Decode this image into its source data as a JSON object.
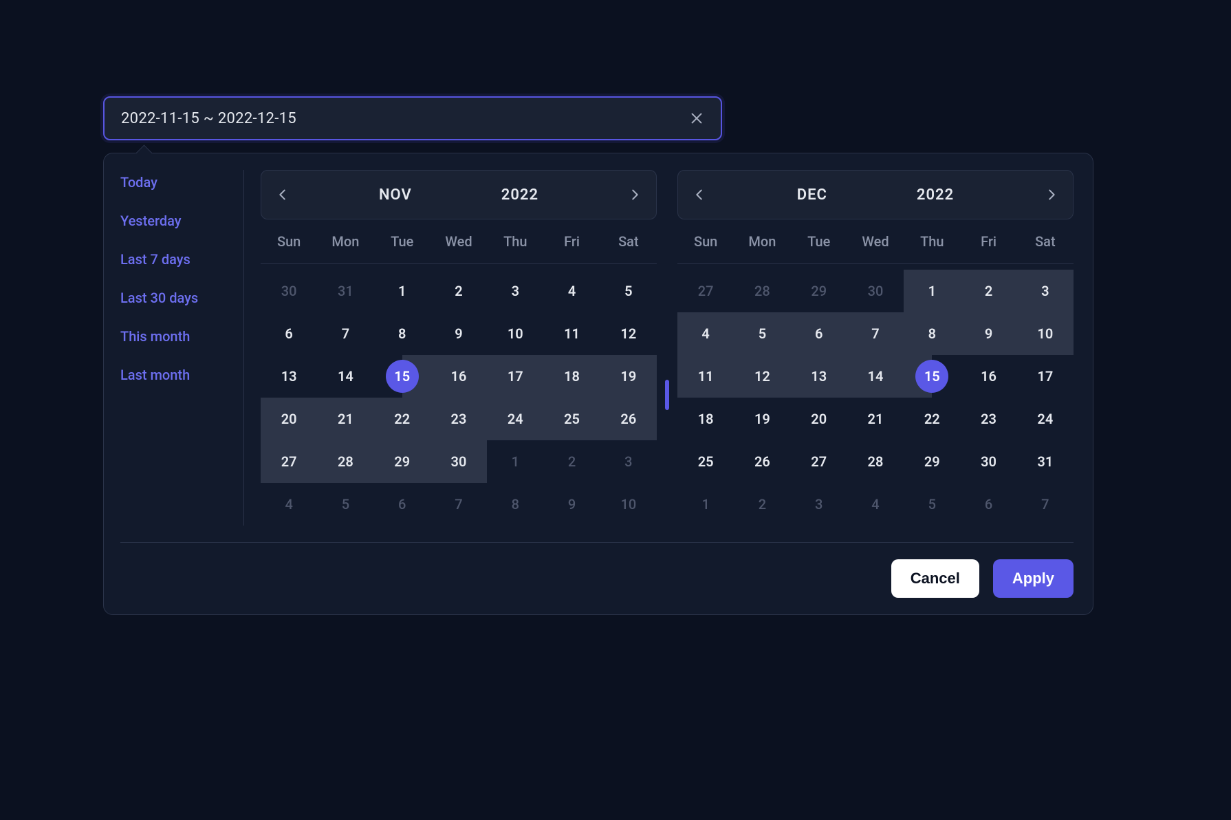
{
  "input": {
    "value": "2022-11-15 ~ 2022-12-15"
  },
  "presets": {
    "items": [
      "Today",
      "Yesterday",
      "Last 7 days",
      "Last 30 days",
      "This month",
      "Last month"
    ]
  },
  "calendars": {
    "weekdays": [
      "Sun",
      "Mon",
      "Tue",
      "Wed",
      "Thu",
      "Fri",
      "Sat"
    ],
    "left": {
      "month": "NOV",
      "year": "2022",
      "days": [
        {
          "n": "30",
          "o": true
        },
        {
          "n": "31",
          "o": true
        },
        {
          "n": "1"
        },
        {
          "n": "2"
        },
        {
          "n": "3"
        },
        {
          "n": "4"
        },
        {
          "n": "5"
        },
        {
          "n": "6"
        },
        {
          "n": "7"
        },
        {
          "n": "8"
        },
        {
          "n": "9"
        },
        {
          "n": "10"
        },
        {
          "n": "11"
        },
        {
          "n": "12"
        },
        {
          "n": "13"
        },
        {
          "n": "14"
        },
        {
          "n": "15",
          "start": true
        },
        {
          "n": "16",
          "r": true
        },
        {
          "n": "17",
          "r": true
        },
        {
          "n": "18",
          "r": true
        },
        {
          "n": "19",
          "r": true
        },
        {
          "n": "20",
          "r": true
        },
        {
          "n": "21",
          "r": true
        },
        {
          "n": "22",
          "r": true
        },
        {
          "n": "23",
          "r": true
        },
        {
          "n": "24",
          "r": true
        },
        {
          "n": "25",
          "r": true
        },
        {
          "n": "26",
          "r": true
        },
        {
          "n": "27",
          "r": true
        },
        {
          "n": "28",
          "r": true
        },
        {
          "n": "29",
          "r": true
        },
        {
          "n": "30",
          "r": true
        },
        {
          "n": "1",
          "o": true
        },
        {
          "n": "2",
          "o": true
        },
        {
          "n": "3",
          "o": true
        },
        {
          "n": "4",
          "o": true
        },
        {
          "n": "5",
          "o": true
        },
        {
          "n": "6",
          "o": true
        },
        {
          "n": "7",
          "o": true
        },
        {
          "n": "8",
          "o": true
        },
        {
          "n": "9",
          "o": true
        },
        {
          "n": "10",
          "o": true
        }
      ]
    },
    "right": {
      "month": "DEC",
      "year": "2022",
      "days": [
        {
          "n": "27",
          "o": true
        },
        {
          "n": "28",
          "o": true
        },
        {
          "n": "29",
          "o": true
        },
        {
          "n": "30",
          "o": true
        },
        {
          "n": "1",
          "r": true
        },
        {
          "n": "2",
          "r": true
        },
        {
          "n": "3",
          "r": true
        },
        {
          "n": "4",
          "r": true
        },
        {
          "n": "5",
          "r": true
        },
        {
          "n": "6",
          "r": true
        },
        {
          "n": "7",
          "r": true
        },
        {
          "n": "8",
          "r": true
        },
        {
          "n": "9",
          "r": true
        },
        {
          "n": "10",
          "r": true
        },
        {
          "n": "11",
          "r": true
        },
        {
          "n": "12",
          "r": true
        },
        {
          "n": "13",
          "r": true
        },
        {
          "n": "14",
          "r": true
        },
        {
          "n": "15",
          "end": true
        },
        {
          "n": "16"
        },
        {
          "n": "17"
        },
        {
          "n": "18"
        },
        {
          "n": "19"
        },
        {
          "n": "20"
        },
        {
          "n": "21"
        },
        {
          "n": "22"
        },
        {
          "n": "23"
        },
        {
          "n": "24"
        },
        {
          "n": "25"
        },
        {
          "n": "26"
        },
        {
          "n": "27"
        },
        {
          "n": "28"
        },
        {
          "n": "29"
        },
        {
          "n": "30"
        },
        {
          "n": "31"
        },
        {
          "n": "1",
          "o": true
        },
        {
          "n": "2",
          "o": true
        },
        {
          "n": "3",
          "o": true
        },
        {
          "n": "4",
          "o": true
        },
        {
          "n": "5",
          "o": true
        },
        {
          "n": "6",
          "o": true
        },
        {
          "n": "7",
          "o": true
        }
      ]
    }
  },
  "footer": {
    "cancel": "Cancel",
    "apply": "Apply"
  }
}
